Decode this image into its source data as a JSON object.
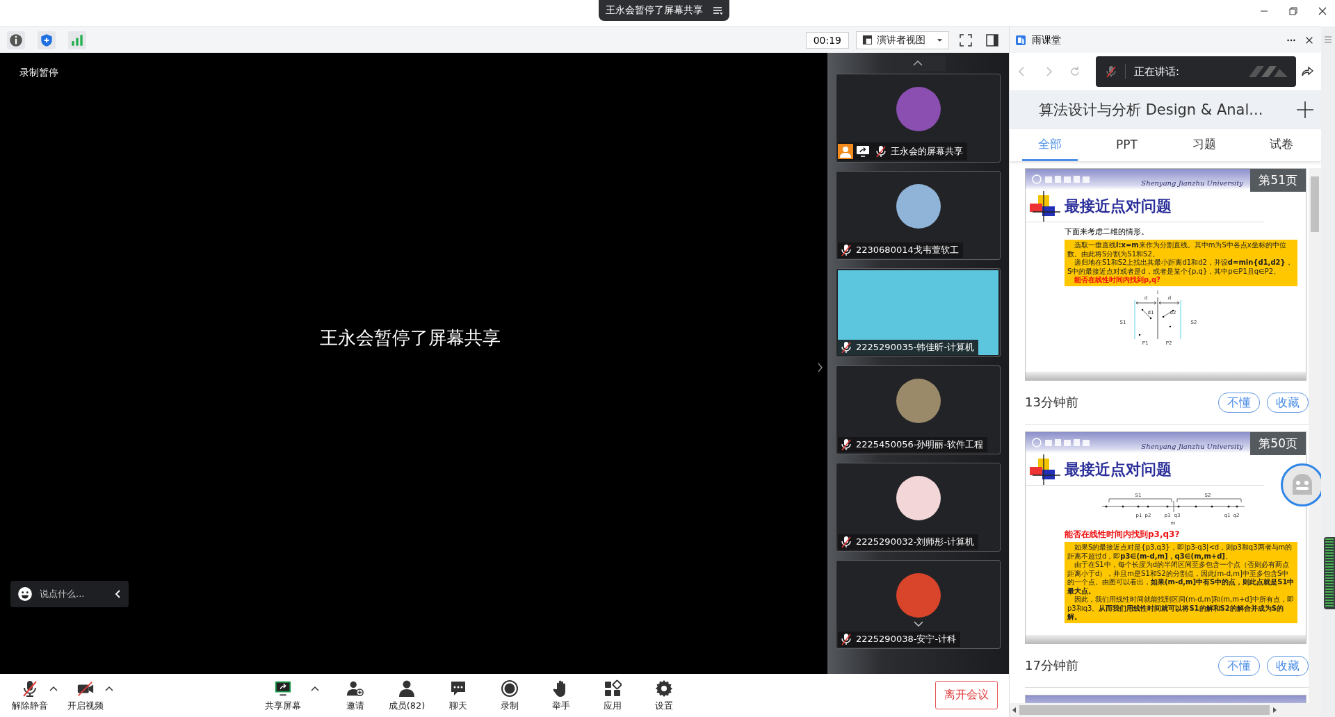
{
  "window": {
    "banner": "王永会暂停了屏幕共享"
  },
  "toolbar": {
    "timer": "00:19",
    "view_mode": "演讲者视图"
  },
  "stage": {
    "recording_status": "录制暂停",
    "message": "王永会暂停了屏幕共享",
    "chat_placeholder": "说点什么..."
  },
  "participants": [
    {
      "name": "王永会的屏幕共享",
      "kind": "avatar",
      "color": "#8a4fb0",
      "host": true,
      "sharing": true,
      "muted": true
    },
    {
      "name": "2230680014戈韦萱软工",
      "kind": "avatar",
      "color": "#8fb4d8",
      "host": false,
      "sharing": false,
      "muted": true
    },
    {
      "name": "2225290035-韩佳昕-计算机",
      "kind": "video",
      "color": "#5cc6de",
      "host": false,
      "sharing": false,
      "muted": true
    },
    {
      "name": "2225450056-孙明丽-软件工程",
      "kind": "avatar",
      "color": "#9a8a6a",
      "host": false,
      "sharing": false,
      "muted": true
    },
    {
      "name": "2225290032-刘师彤-计算机",
      "kind": "avatar",
      "color": "#f2d6d8",
      "host": false,
      "sharing": false,
      "muted": true
    },
    {
      "name": "2225290038-安宁-计科",
      "kind": "avatar",
      "color": "#d8452a",
      "host": false,
      "sharing": false,
      "muted": true
    }
  ],
  "side_panel": {
    "app_title": "雨课堂",
    "speaking_label": "正在讲话:",
    "course_title": "算法设计与分析 Design & Anal...",
    "tabs": [
      {
        "label": "全部",
        "selected": true
      },
      {
        "label": "PPT",
        "selected": false
      },
      {
        "label": "习题",
        "selected": false
      },
      {
        "label": "试卷",
        "selected": false
      }
    ],
    "feed": [
      {
        "page": "第51页",
        "university": "Shenyang Jianzhu University",
        "title": "最接近点对问题",
        "bullet": "下面来考虑二维的情形。",
        "kind": "strips",
        "paragraphs": [
          "选取一垂直线**l:x=m**来作为分割直线。其中m为S中各点x坐标的中位数。由此将S分割为S1和S2。",
          "递归地在S1和S2上找出其最小距离d1和d2，并设**d=min{d1,d2}**，S中的最接近点对或者是d，或者是某个{p,q}，其中p∈P1且q∈P2。"
        ],
        "question": "能否在线性时间内找到p,q?",
        "diagram_labels": [
          "d",
          "d",
          "l",
          "d1",
          "d2",
          "S1",
          "S2",
          "P1",
          "P2"
        ],
        "time": "13分钟前",
        "buttons": [
          "不懂",
          "收藏"
        ]
      },
      {
        "page": "第50页",
        "university": "Shenyang Jianzhu University",
        "title": "最接近点对问题",
        "kind": "points",
        "diagram_labels": [
          "S1",
          "S2",
          "p1",
          "p2",
          "p3",
          "q3",
          "q1",
          "q2",
          "m"
        ],
        "question": "能否在线性时间内找到p3,q3?",
        "paragraphs": [
          "如果S的最接近点对是{p3,q3}，即|p3-q3|<d，则p3和q3两者与m的距离不超过d，即**p3∈(m-d,m]，q3∈(m,m+d]**。",
          "由于在S1中，每个长度为d的半闭区间至多包含一个点（否则必有两点距离小于d），并且m是S1和S2的分割点，因此(m-d,m]中至多包含S中的一个点。由图可以看出，**如果(m-d,m]中有S中的点，则此点就是S1中最大点。**",
          "因此，我们用线性时间就能找到区间(m-d,m]和(m,m+d]中所有点，即p3和q3。**从而我们用线性时间就可以将S1的解和S2的解合并成为S的解。**"
        ],
        "time": "17分钟前",
        "buttons": [
          "不懂",
          "收藏"
        ]
      }
    ]
  },
  "controls_left": [
    {
      "label": "解除静音",
      "kind": "mic-off",
      "menu": true
    },
    {
      "label": "开启视频",
      "kind": "camera-off",
      "menu": true
    }
  ],
  "controls_center": [
    {
      "label": "共享屏幕",
      "kind": "share",
      "menu": true
    },
    {
      "label": "邀请",
      "kind": "invite",
      "menu": false
    },
    {
      "label": "成员(82)",
      "kind": "members",
      "menu": false
    },
    {
      "label": "聊天",
      "kind": "chat",
      "menu": false
    },
    {
      "label": "录制",
      "kind": "record",
      "menu": false
    },
    {
      "label": "举手",
      "kind": "hand",
      "menu": false
    },
    {
      "label": "应用",
      "kind": "apps",
      "menu": false
    },
    {
      "label": "设置",
      "kind": "settings",
      "menu": false
    }
  ],
  "leave_button": "离开会议"
}
